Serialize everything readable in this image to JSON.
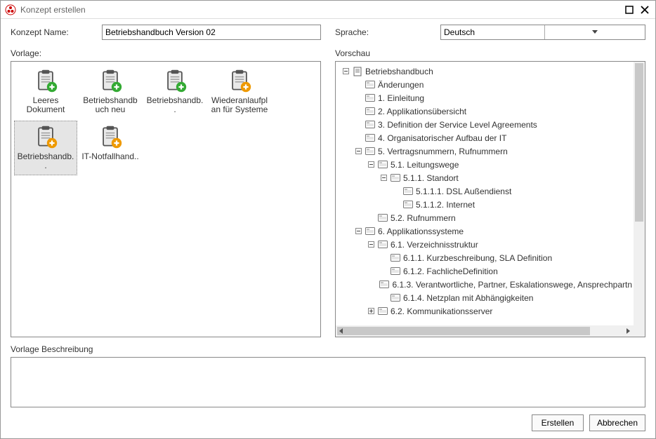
{
  "window": {
    "title": "Konzept erstellen"
  },
  "form": {
    "name_label": "Konzept Name:",
    "name_value": "Betriebshandbuch Version 02",
    "lang_label": "Sprache:",
    "lang_value": "Deutsch",
    "template_label": "Vorlage:",
    "preview_label": "Vorschau",
    "desc_label": "Vorlage Beschreibung"
  },
  "templates": [
    {
      "label": "Leeres Dokument",
      "badge": "green"
    },
    {
      "label": "Betriebshandbuch neu",
      "badge": "green"
    },
    {
      "label": "Betriebshandb..",
      "badge": "green"
    },
    {
      "label": "Wiederanlaufplan für Systeme",
      "badge": "orange"
    },
    {
      "label": "Betriebshandb..",
      "badge": "orange",
      "selected": true
    },
    {
      "label": "IT-Notfallhand..",
      "badge": "orange"
    }
  ],
  "tree": [
    {
      "l": 0,
      "t": "exp",
      "i": "doc",
      "x": "Betriebshandbuch"
    },
    {
      "l": 1,
      "t": "",
      "i": "pg",
      "x": "Änderungen"
    },
    {
      "l": 1,
      "t": "",
      "i": "pg",
      "x": "1. Einleitung"
    },
    {
      "l": 1,
      "t": "",
      "i": "pg",
      "x": "2. Applikationsübersicht"
    },
    {
      "l": 1,
      "t": "",
      "i": "pg",
      "x": "3. Definition der Service Level Agreements"
    },
    {
      "l": 1,
      "t": "",
      "i": "pg",
      "x": "4. Organisatorischer Aufbau der IT"
    },
    {
      "l": 1,
      "t": "exp",
      "i": "pg",
      "x": "5. Vertragsnummern, Rufnummern"
    },
    {
      "l": 2,
      "t": "exp",
      "i": "pg",
      "x": "5.1. Leitungswege"
    },
    {
      "l": 3,
      "t": "exp",
      "i": "pg",
      "x": "5.1.1. Standort"
    },
    {
      "l": 4,
      "t": "",
      "i": "pg",
      "x": "5.1.1.1. DSL Außendienst"
    },
    {
      "l": 4,
      "t": "",
      "i": "pg",
      "x": "5.1.1.2. Internet"
    },
    {
      "l": 2,
      "t": "",
      "i": "pg",
      "x": "5.2. Rufnummern"
    },
    {
      "l": 1,
      "t": "exp",
      "i": "pg",
      "x": "6. Applikationssysteme"
    },
    {
      "l": 2,
      "t": "exp",
      "i": "pg",
      "x": "6.1. Verzeichnisstruktur"
    },
    {
      "l": 3,
      "t": "",
      "i": "pg",
      "x": "6.1.1. Kurzbeschreibung, SLA Definition"
    },
    {
      "l": 3,
      "t": "",
      "i": "pg",
      "x": "6.1.2. FachlicheDefinition"
    },
    {
      "l": 3,
      "t": "",
      "i": "pg",
      "x": "6.1.3. Verantwortliche, Partner, Eskalationswege, Ansprechpartn"
    },
    {
      "l": 3,
      "t": "",
      "i": "pg",
      "x": "6.1.4. Netzplan mit Abhängigkeiten"
    },
    {
      "l": 2,
      "t": "col",
      "i": "pg",
      "x": "6.2. Kommunikationsserver"
    }
  ],
  "buttons": {
    "create": "Erstellen",
    "cancel": "Abbrechen"
  }
}
